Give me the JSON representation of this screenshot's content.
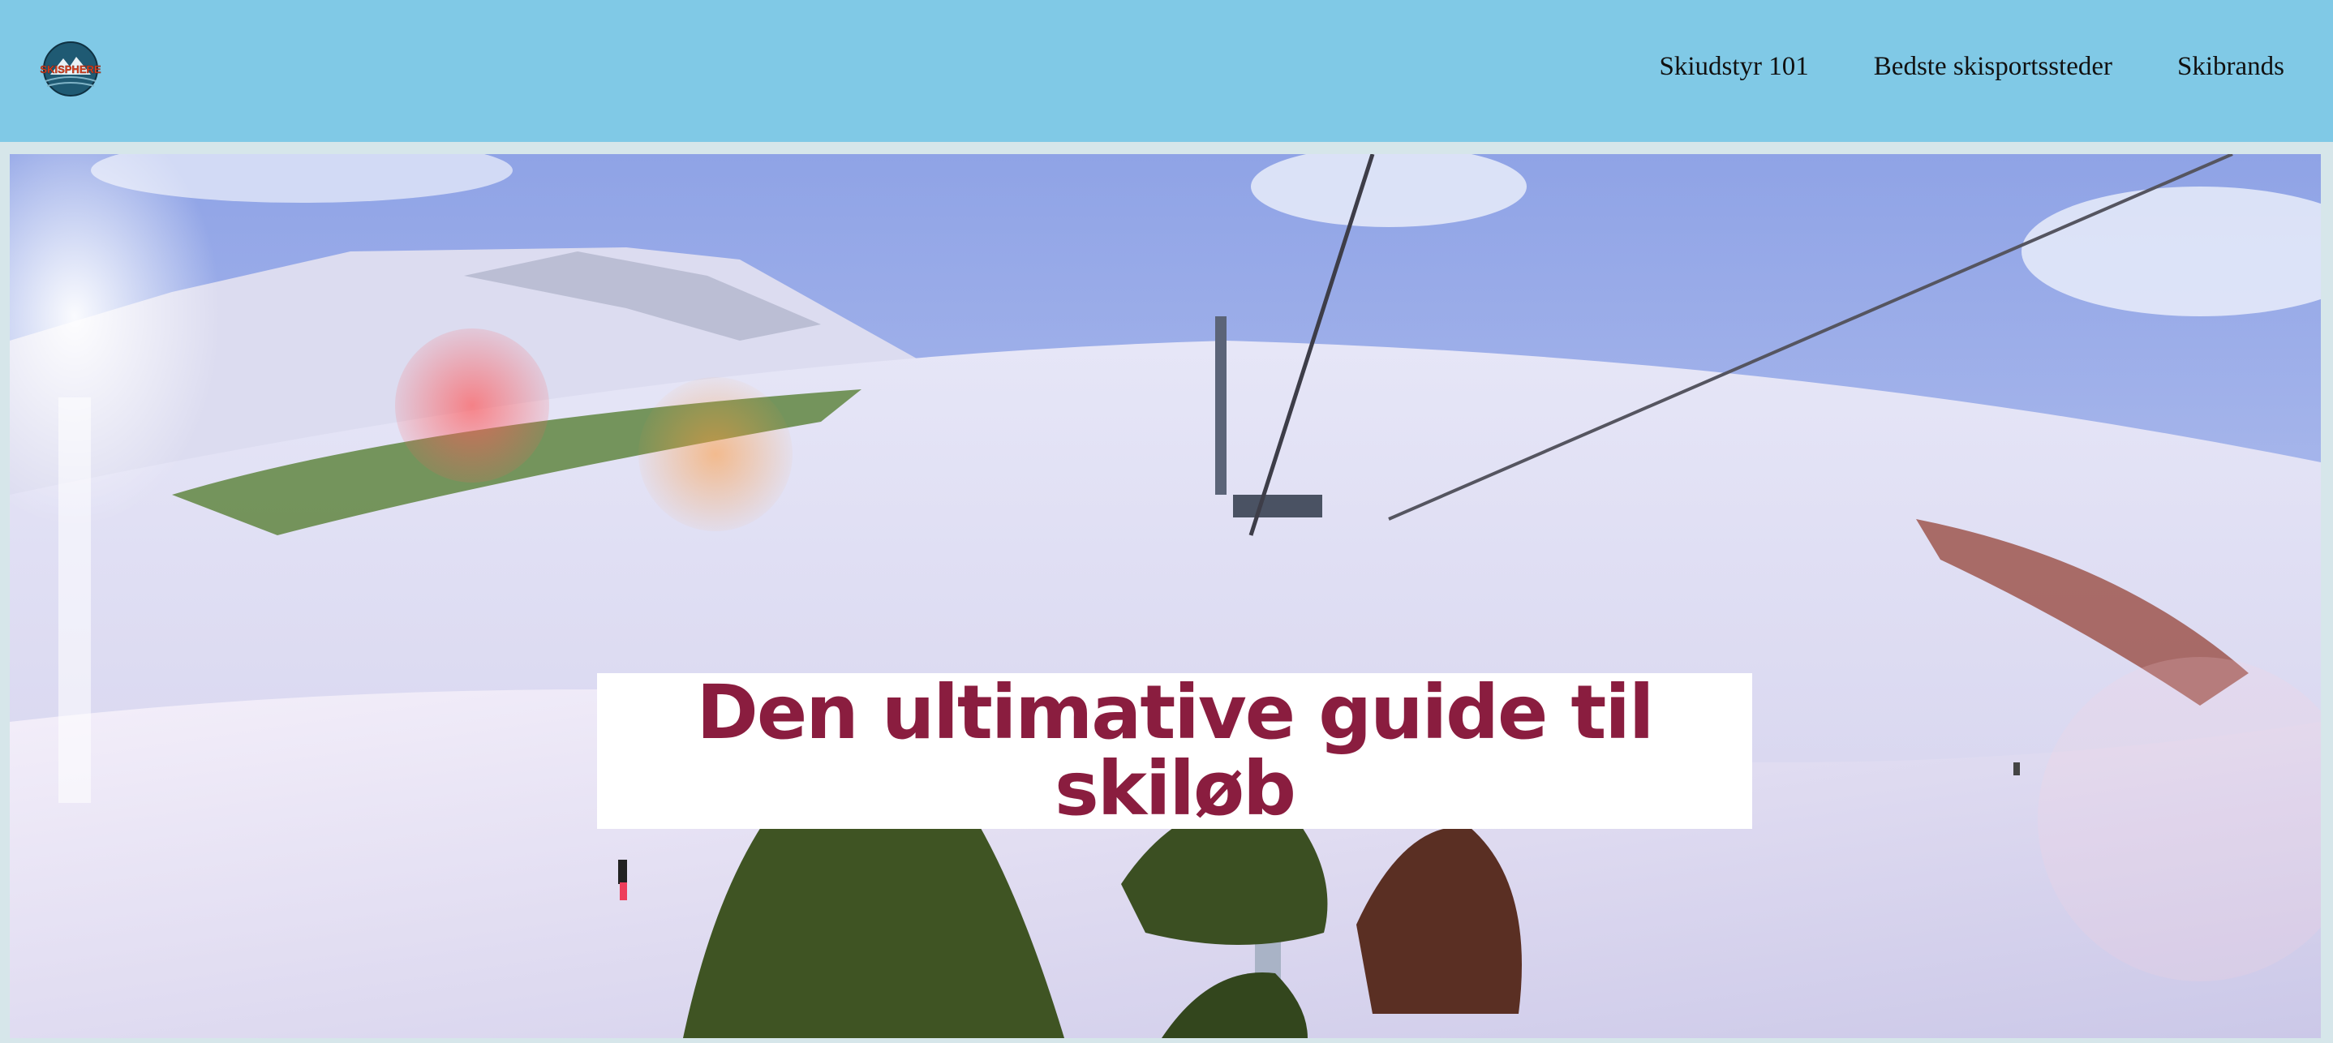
{
  "header": {
    "logo": {
      "text": "SKISPHERE",
      "icon": "mountain-logo-icon",
      "colors": {
        "badge": "#1f5a73",
        "text": "#e2431f"
      }
    },
    "nav": [
      {
        "label": "Skiudstyr 101"
      },
      {
        "label": "Bedste skisportssteder"
      },
      {
        "label": "Skibrands"
      }
    ],
    "colors": {
      "background": "#80c9e6"
    }
  },
  "hero": {
    "title": "Den ultimative guide til skiløb",
    "image": "ski-slope-chairlift-photo",
    "colors": {
      "title": "#8a1d3f",
      "title_background": "#ffffff"
    }
  }
}
